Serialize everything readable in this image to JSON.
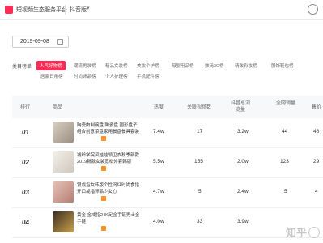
{
  "topbar": {
    "brand": "短视频生态服务平台",
    "sub": "抖音版"
  },
  "filters": {
    "date": "2019-09-08",
    "label": "类目榜单"
  },
  "categories": [
    "人气好物榜",
    "潮流男装榜",
    "精品女装榜",
    "美妆个护榜",
    "母婴用品榜",
    "数码3C榜",
    "精致彩妆榜",
    "服饰鞋包榜",
    "居家日用榜",
    "时尚饰品榜",
    "个人护理榜",
    "手机配件榜"
  ],
  "table": {
    "headers": [
      "排行",
      "商品",
      "热度",
      "关联视频数",
      "抖音总浏览量",
      "全网销量",
      "售价"
    ],
    "rows": [
      {
        "rank": "01",
        "title": "陶瓷肉制碗盘 陶瓷盘 圆形盘子组合创意菜盘家用餐盘餐具套装",
        "heat": "7.4w",
        "videos": "17",
        "views": "3.2w",
        "sales": "44",
        "price": "48"
      },
      {
        "rank": "02",
        "title": "减龄学院风娃娃领卫衣秋季新款2019新款女装宽松外套韩版",
        "heat": "5.5w",
        "videos": "155",
        "views": "2.0w",
        "sales": "123",
        "price": "29"
      },
      {
        "rank": "03",
        "title": "银戒指女韩版个性网红时尚食指开口戒指饰品少女心",
        "heat": "4.7w",
        "videos": "5",
        "views": "2.4w",
        "sales": "5",
        "price": "4"
      },
      {
        "rank": "04",
        "title": "黄金 金戒指24K足金手链男士金手链",
        "heat": "4.0w",
        "videos": "33",
        "views": "3.9w",
        "sales": "",
        "price": ""
      }
    ]
  },
  "colors": {
    "accent": "#fe2c55",
    "tag": "#ff8f1f"
  },
  "watermark": "知乎"
}
